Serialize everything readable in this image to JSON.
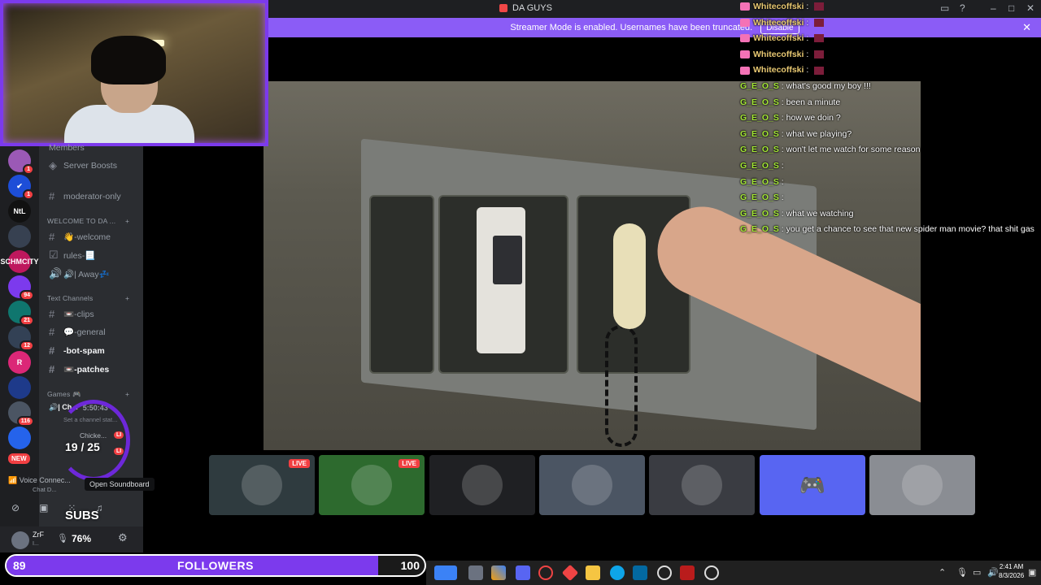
{
  "window": {
    "title": "DA GUYS"
  },
  "banner": {
    "text": "Streamer Mode is enabled. Usernames have been truncated.",
    "disable_label": "Disable",
    "close": "✕"
  },
  "colors": {
    "accent": "#8b5cf6",
    "live": "#f23f42",
    "chat_user": "#e8c872",
    "chat_user_alt": "#a3e635"
  },
  "servers": [
    {
      "label": "",
      "badge": "1",
      "color": "#9b59b6"
    },
    {
      "label": "✔",
      "badge": "1",
      "color": "#1d4ed8"
    },
    {
      "label": "NtL",
      "badge": "",
      "color": "#111"
    },
    {
      "label": "",
      "badge": "",
      "color": "#374151"
    },
    {
      "label": "SCHMCITY",
      "badge": "",
      "color": "#be185d"
    },
    {
      "label": "",
      "badge": "94",
      "color": "#7c3aed"
    },
    {
      "label": "",
      "badge": "21",
      "color": "#0f766e"
    },
    {
      "label": "",
      "badge": "12",
      "color": "#334155"
    },
    {
      "label": "R",
      "badge": "",
      "color": "#db2777"
    },
    {
      "label": "",
      "badge": "",
      "color": "#1e3a8a"
    },
    {
      "label": "",
      "badge": "116",
      "color": "#4b5563"
    },
    {
      "label": "",
      "badge": "",
      "color": "#2563eb"
    }
  ],
  "new_badge": "NEW",
  "channels": {
    "members": "Members",
    "server_boosts": "Server Boosts",
    "moderator_only": "moderator-only",
    "cat_welcome": "WELCOME TO DA ...",
    "welcome": "👋-welcome",
    "rules": "rules-📃",
    "away": "🔊| Away💤",
    "cat_text": "Text Channels",
    "clips": "📼-clips",
    "general": "💬-general",
    "bot_spam": "-bot-spam",
    "patches": "📼-patches",
    "cat_games": "Games 🎮",
    "voice_channel": "🔊| Ch...",
    "voice_time": "5:50:43",
    "status_hint": "Set a channel stat...",
    "voice_user": "Chicke...",
    "live1": "LI",
    "live2": "LI"
  },
  "overlay": {
    "subs_count": "19 / 25",
    "subs_label": "SUBS"
  },
  "voice": {
    "connected": "Voice Connec...",
    "sub": "Chat D...",
    "tooltip": "Open Soundboard"
  },
  "user": {
    "name": "ZrF",
    "sub": "I...",
    "volume": "76%"
  },
  "chat": [
    {
      "user": "Whitecoffski",
      "text": "",
      "alt": false,
      "emote": true
    },
    {
      "user": "Whitecoffski",
      "text": "",
      "alt": false,
      "emote": true
    },
    {
      "user": "Whitecoffski",
      "text": "",
      "alt": false,
      "emote": true
    },
    {
      "user": "Whitecoffski",
      "text": "",
      "alt": false,
      "emote": true
    },
    {
      "user": "Whitecoffski",
      "text": "",
      "alt": false,
      "emote": true
    },
    {
      "user": "G_E_O_S",
      "text": "what's good my boy !!!",
      "alt": true,
      "emote": false
    },
    {
      "user": "G_E_O_S",
      "text": "been a minute",
      "alt": true,
      "emote": false
    },
    {
      "user": "G_E_O_S",
      "text": "how we doin ?",
      "alt": true,
      "emote": false
    },
    {
      "user": "G_E_O_S",
      "text": "what we playing?",
      "alt": true,
      "emote": false
    },
    {
      "user": "G_E_O_S",
      "text": "won't let me watch for some reason",
      "alt": true,
      "emote": false
    },
    {
      "user": "G_E_O_S",
      "text": "",
      "alt": true,
      "emote": false
    },
    {
      "user": "G_E_O_S",
      "text": "",
      "alt": true,
      "emote": false
    },
    {
      "user": "G_E_O_S",
      "text": "",
      "alt": true,
      "emote": false
    },
    {
      "user": "G_E_O_S",
      "text": "what we watching",
      "alt": true,
      "emote": false
    },
    {
      "user": "G_E_O_S",
      "text": "you get a chance to see that new spider man movie? that shit gas",
      "alt": true,
      "emote": false
    }
  ],
  "thumbnails": [
    {
      "live": "LIVE",
      "color": "#2f3b3f"
    },
    {
      "live": "LIVE",
      "color": "#2d6a2e"
    },
    {
      "live": "",
      "color": "#1f2023"
    },
    {
      "live": "",
      "color": "#4b5563"
    },
    {
      "live": "",
      "color": "#3a3c42"
    },
    {
      "live": "",
      "color": "#5865f2"
    },
    {
      "live": "",
      "color": "#8a8d93"
    }
  ],
  "followers": {
    "current": "89",
    "label": "FOLLOWERS",
    "goal": "100",
    "progress": 0.89
  },
  "clock": {
    "time": "2:41 AM",
    "date": "8/3/2026"
  }
}
